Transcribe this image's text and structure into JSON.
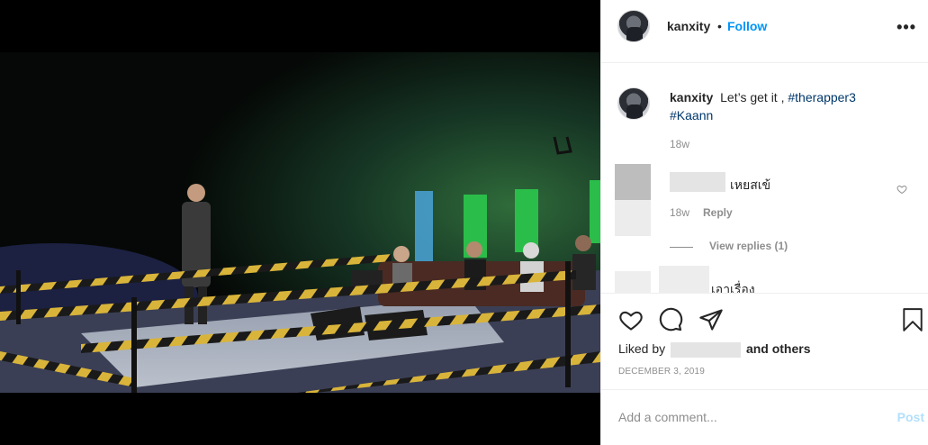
{
  "header": {
    "username": "kanxity",
    "separator": "•",
    "follow_label": "Follow",
    "more_label": "•••"
  },
  "caption": {
    "username": "kanxity",
    "text": "Let’s get it ,",
    "tag1": "#therapper3",
    "tag2": "#Kaann",
    "age": "18w"
  },
  "comments": [
    {
      "text": "เหยสเข้",
      "age": "18w",
      "reply_label": "Reply",
      "view_replies": "View replies (1)"
    },
    {
      "text": "เอาเรื่อง"
    }
  ],
  "actions": {
    "liked_prefix": "Liked by",
    "liked_suffix": "and others",
    "date": "December 3, 2019"
  },
  "add_comment": {
    "placeholder": "Add a comment...",
    "post_label": "Post"
  },
  "icons": [
    "heart-icon",
    "comment-icon",
    "share-icon",
    "bookmark-icon",
    "more-options-icon"
  ],
  "colors": {
    "accent": "#0095f6",
    "hashtag": "#00376b",
    "meta_grey": "#8e8e8e",
    "post_disabled": "#b2dffc"
  }
}
